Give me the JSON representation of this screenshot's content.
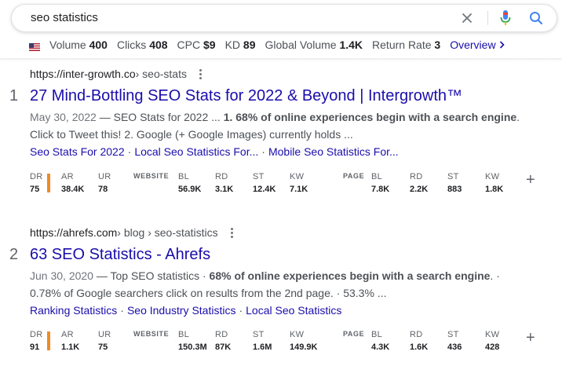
{
  "search": {
    "query": "seo statistics",
    "clear_icon": "close-icon",
    "mic_icon": "microphone-icon",
    "search_icon": "search-icon"
  },
  "metrics": {
    "flag_icon": "us-flag-icon",
    "items": [
      {
        "label": "Volume",
        "value": "400"
      },
      {
        "label": "Clicks",
        "value": "408"
      },
      {
        "label": "CPC",
        "value": "$9"
      },
      {
        "label": "KD",
        "value": "89"
      },
      {
        "label": "Global Volume",
        "value": "1.4K"
      },
      {
        "label": "Return Rate",
        "value": "3"
      }
    ],
    "overview_label": "Overview"
  },
  "results": [
    {
      "number": "1",
      "domain": "https://inter-growth.co",
      "path": " › seo-stats",
      "title": "27 Mind-Bottling SEO Stats for 2022 & Beyond | Intergrowth™",
      "date": "May 30, 2022",
      "snippet_1a": " — SEO Stats for 2022 ... ",
      "snippet_1b": "1. 68% of online experiences begin with a search engine",
      "snippet_1c": ".",
      "snippet_2": "Click to Tweet this! 2. Google (+ Google Images) currently holds ...",
      "sitelinks": [
        "Seo Stats For 2022",
        "Local Seo Statistics For...",
        "Mobile Seo Statistics For..."
      ],
      "ahrefs": {
        "dr": "75",
        "ar": "38.4K",
        "ur": "78",
        "website": {
          "bl": "56.9K",
          "rd": "3.1K",
          "st": "12.4K",
          "kw": "7.1K"
        },
        "page": {
          "bl": "7.8K",
          "rd": "2.2K",
          "st": "883",
          "kw": "1.8K"
        }
      }
    },
    {
      "number": "2",
      "domain": "https://ahrefs.com",
      "path": " › blog › seo-statistics",
      "title": "63 SEO Statistics - Ahrefs",
      "date": "Jun 30, 2020",
      "snippet_1a": " — Top SEO statistics · ",
      "snippet_1b": "68% of online experiences begin with a search engine",
      "snippet_1c": ". ·",
      "snippet_2": "0.78% of Google searchers click on results from the 2nd page. · 53.3% ...",
      "sitelinks": [
        "Ranking Statistics",
        "Seo Industry Statistics",
        "Local Seo Statistics"
      ],
      "ahrefs": {
        "dr": "91",
        "ar": "1.1K",
        "ur": "75",
        "website": {
          "bl": "150.3M",
          "rd": "87K",
          "st": "1.6M",
          "kw": "149.9K"
        },
        "page": {
          "bl": "4.3K",
          "rd": "1.6K",
          "st": "436",
          "kw": "428"
        }
      }
    }
  ],
  "ahrefs_labels": {
    "dr": "DR",
    "ar": "AR",
    "ur": "UR",
    "website": "WEBSITE",
    "page": "PAGE",
    "bl": "BL",
    "rd": "RD",
    "st": "ST",
    "kw": "KW",
    "plus": "+"
  },
  "colors": {
    "link": "#1a0dab",
    "dr_bar": "#f08a24",
    "mic_blue": "#4285f4",
    "mic_red": "#ea4335"
  }
}
